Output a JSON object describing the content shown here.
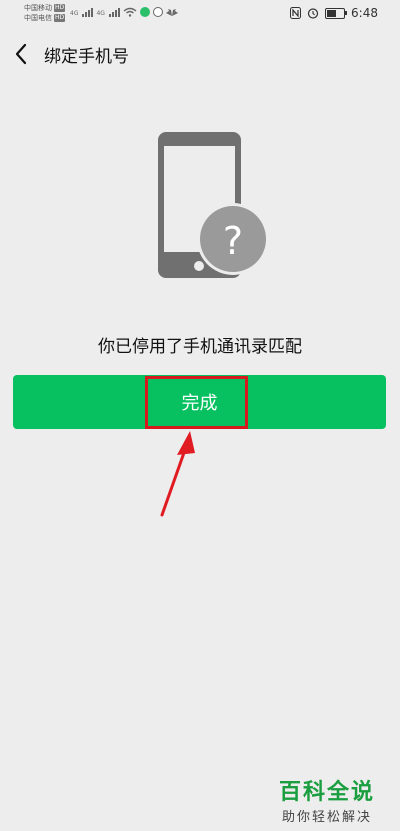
{
  "status_bar": {
    "carrier1": "中国移动",
    "carrier2": "中国电信",
    "hd_badge": "HD",
    "network_tag": "4G",
    "time": "6:48",
    "battery_level": 0.55,
    "icons": [
      "signal-icon",
      "wifi-icon",
      "nfc-icon",
      "alarm-icon",
      "battery-icon"
    ]
  },
  "header": {
    "title": "绑定手机号",
    "back_icon": "back-arrow-icon"
  },
  "illustration": {
    "icon": "phone-question-icon",
    "symbol": "?"
  },
  "message": "你已停用了手机通讯录匹配",
  "done_button": {
    "label": "完成"
  },
  "colors": {
    "background": "#ededed",
    "accent": "#07c160",
    "highlight": "#d6191c",
    "illustration": "#707070"
  },
  "watermark": {
    "title": "百科全说",
    "subtitle": "助你轻松解决"
  }
}
